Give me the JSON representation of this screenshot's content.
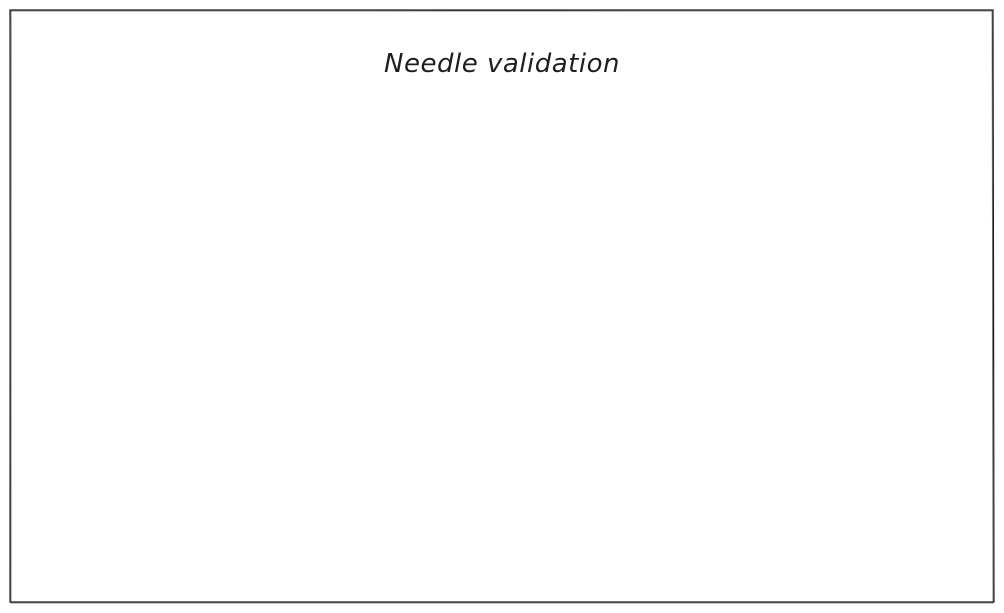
{
  "frame": {
    "title": "Needle validation",
    "stroke_color": "#1e1e1e",
    "background_color": "#ffffff"
  }
}
